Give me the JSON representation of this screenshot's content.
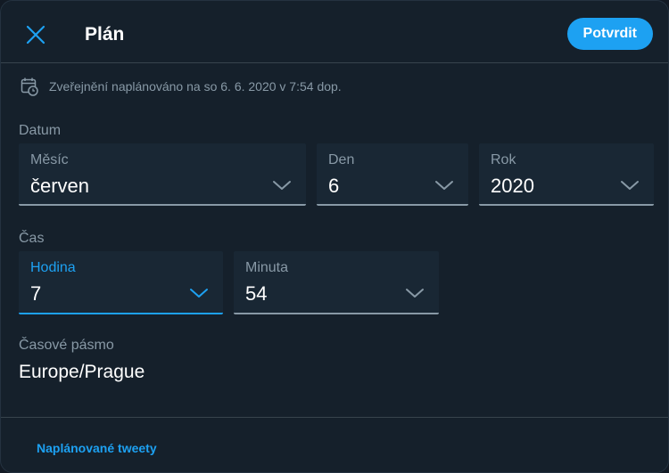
{
  "header": {
    "title": "Plán",
    "confirm_label": "Potvrdit",
    "close_icon": "close-icon"
  },
  "schedule_info": {
    "icon": "calendar-clock-icon",
    "text": "Zveřejnění naplánováno na so 6. 6. 2020 v 7:54 dop."
  },
  "date": {
    "section_label": "Datum",
    "month": {
      "label": "Měsíc",
      "value": "červen"
    },
    "day": {
      "label": "Den",
      "value": "6"
    },
    "year": {
      "label": "Rok",
      "value": "2020"
    }
  },
  "time": {
    "section_label": "Čas",
    "hour": {
      "label": "Hodina",
      "value": "7",
      "focused": true
    },
    "minute": {
      "label": "Minuta",
      "value": "54"
    }
  },
  "timezone": {
    "label": "Časové pásmo",
    "value": "Europe/Prague"
  },
  "footer": {
    "link_label": "Naplánované tweety"
  },
  "colors": {
    "background": "#15202b",
    "field_background": "#192734",
    "accent": "#1da1f2",
    "muted_text": "#8899a6",
    "border": "#38444d"
  }
}
